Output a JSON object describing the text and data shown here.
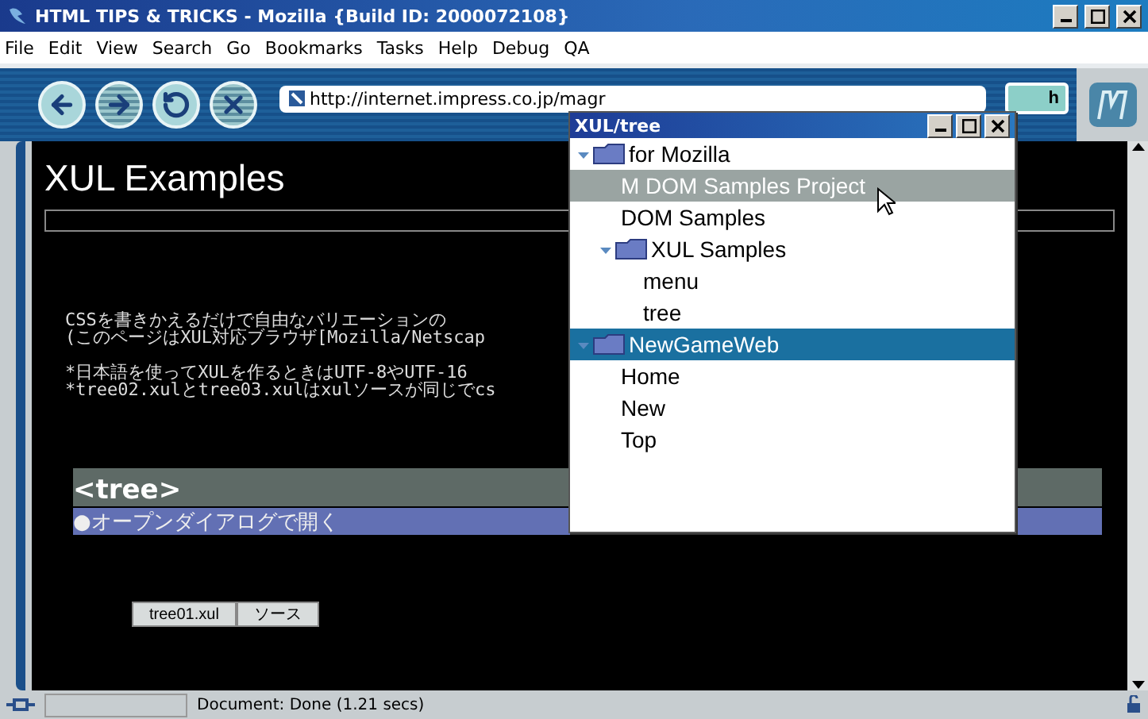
{
  "window": {
    "title": "HTML TIPS & TRICKS - Mozilla {Build ID: 2000072108}"
  },
  "menu": [
    "File",
    "Edit",
    "View",
    "Search",
    "Go",
    "Bookmarks",
    "Tasks",
    "Help",
    "Debug",
    "QA"
  ],
  "nav_buttons": [
    {
      "kind": "back",
      "disabled": false
    },
    {
      "kind": "forward",
      "disabled": true
    },
    {
      "kind": "reload",
      "disabled": false
    },
    {
      "kind": "stop",
      "disabled": true
    }
  ],
  "address": {
    "value": "http://internet.impress.co.jp/magr"
  },
  "search_button": "h",
  "page": {
    "heading": "XUL Examples",
    "paragraphs": [
      [
        "CSSを書きかえるだけで自由なバリエーションの",
        "(このページはXUL対応ブラウザ[Mozilla/Netscap"
      ],
      [
        "*日本語を使ってXULを作るときはUTF-8やUTF-16",
        "*tree02.xulとtree03.xulはxulソースが同じでcs"
      ]
    ],
    "section_title": "<tree>",
    "link_bar": "●オープンダイアログで開く",
    "buttons": [
      "tree01.xul",
      "ソース"
    ]
  },
  "status_bar": {
    "text": "Document: Done (1.21 secs)"
  },
  "dialog": {
    "title": "XUL/tree",
    "tree": [
      {
        "label": "for Mozilla",
        "folder": true,
        "expanded": true,
        "selected": false,
        "hovered": false,
        "children": [
          {
            "label": "M DOM Samples Project",
            "folder": false,
            "selected": false,
            "hovered": true
          },
          {
            "label": "DOM Samples",
            "folder": false,
            "selected": false,
            "hovered": false
          },
          {
            "label": "XUL Samples",
            "folder": true,
            "expanded": true,
            "selected": false,
            "hovered": false,
            "children": [
              {
                "label": "menu",
                "folder": false,
                "selected": false,
                "hovered": false
              },
              {
                "label": "tree",
                "folder": false,
                "selected": false,
                "hovered": false
              }
            ]
          }
        ]
      },
      {
        "label": "NewGameWeb",
        "folder": true,
        "expanded": true,
        "selected": true,
        "hovered": false,
        "children": [
          {
            "label": "Home",
            "folder": false,
            "selected": false,
            "hovered": false
          },
          {
            "label": "New",
            "folder": false,
            "selected": false,
            "hovered": false
          },
          {
            "label": "Top",
            "folder": false,
            "selected": false,
            "hovered": false
          }
        ]
      }
    ]
  }
}
